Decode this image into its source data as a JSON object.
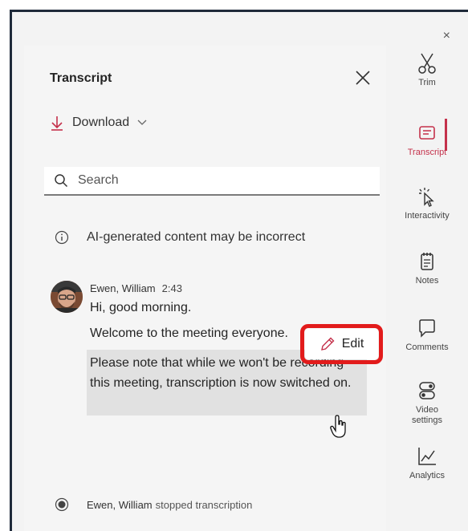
{
  "window": {
    "close_glyph": "×"
  },
  "panel": {
    "title": "Transcript",
    "download_label": "Download",
    "search_placeholder": "Search",
    "disclaimer": "AI-generated content may be incorrect"
  },
  "entry": {
    "speaker": "Ewen, William",
    "time": "2:43",
    "line1": "Hi, good morning.",
    "line2": "Welcome to the meeting everyone.",
    "selected": "Please note that while we won't be recording this meeting, transcription is now switched on."
  },
  "edit": {
    "label": "Edit"
  },
  "status": {
    "speaker": "Ewen, William",
    "action": "stopped transcription"
  },
  "sidebar": {
    "items": [
      {
        "label": "Trim",
        "icon": "scissors-icon"
      },
      {
        "label": "Transcript",
        "icon": "transcript-icon"
      },
      {
        "label": "Interactivity",
        "icon": "interactivity-icon"
      },
      {
        "label": "Notes",
        "icon": "notes-icon"
      },
      {
        "label": "Comments",
        "icon": "comment-icon"
      },
      {
        "label": "Video settings",
        "icon": "toggle-icon"
      },
      {
        "label": "Analytics",
        "icon": "analytics-icon"
      }
    ]
  },
  "colors": {
    "accent": "#c4314b",
    "highlight_border": "#e21b1b",
    "selection": "#e1e1e1"
  }
}
